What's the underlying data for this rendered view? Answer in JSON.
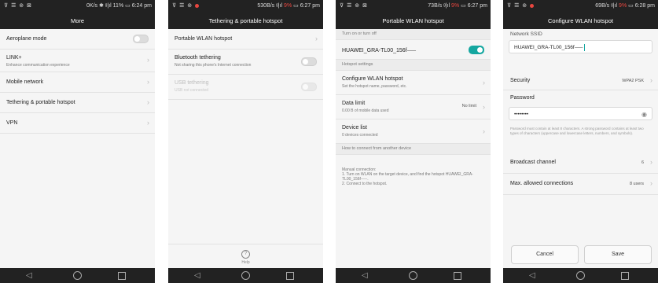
{
  "screens": [
    {
      "status": {
        "left": "⊽ ☰ ⊚ ⊠",
        "right_text": "0K/s ✱ ᵍ|ıl 11%",
        "time": "6:24 pm",
        "red_pct": ""
      },
      "title": "More",
      "items": [
        {
          "label": "Aeroplane mode",
          "sub": ""
        },
        {
          "label": "LINK+",
          "sub": "Enhance communication experience"
        },
        {
          "label": "Mobile network",
          "sub": ""
        },
        {
          "label": "Tethering & portable hotspot",
          "sub": ""
        },
        {
          "label": "VPN",
          "sub": ""
        }
      ]
    },
    {
      "status": {
        "left": "⊽ ☰ ⊚",
        "right_text": "530B/s ᵍ|ıl",
        "red_pct": "9%",
        "time": "6:27 pm"
      },
      "title": "Tethering & portable hotspot",
      "items": [
        {
          "label": "Portable WLAN hotspot",
          "sub": ""
        },
        {
          "label": "Bluetooth tethering",
          "sub": "Not sharing this phone's Internet connection"
        },
        {
          "label": "USB tethering",
          "sub": "USB not connected"
        }
      ],
      "help": "Help",
      "help_icon": "?"
    },
    {
      "status": {
        "left": "⊽ ☰ ⊚ ⊠",
        "right_text": "73B/s ᵍ|ıl",
        "red_pct": "9%",
        "time": "6:27 pm"
      },
      "title": "Portable WLAN hotspot",
      "section_toggle": "Turn on or turn off",
      "hotspot_name": "HUAWEI_GRA-TL00_156f⸺",
      "section_settings": "Hotspot settings",
      "items": [
        {
          "label": "Configure WLAN hotspot",
          "sub": "Set the hotspot name, password, etc."
        },
        {
          "label": "Data limit",
          "sub": "0.00 B of mobile data used",
          "value": "No limit"
        },
        {
          "label": "Device list",
          "sub": "0 devices connected"
        }
      ],
      "section_connect": "How to connect from another device",
      "manual": "Manual connection:\n1. Turn on WLAN on the target device, and find the hotspot HUAWEI_GRA-TL00_156f⸺.\n2. Connect to the hotspot."
    },
    {
      "status": {
        "left": "⊽ ☰ ⊚",
        "right_text": "69B/s ᵍ|ıl",
        "red_pct": "9%",
        "time": "6:28 pm"
      },
      "title": "Configure WLAN hotspot",
      "ssid_label": "Network SSID",
      "ssid_value": "HUAWEI_GRA-TL00_156f⸺",
      "security_label": "Security",
      "security_value": "WPA2 PSK",
      "password_label": "Password",
      "password_value": "••••••••",
      "password_hint": "Password must contain at least 8 characters. A strong password contains at least two types of characters (uppercase and lowercase letters, numbers, and symbols).",
      "broadcast_label": "Broadcast channel",
      "broadcast_value": "6",
      "max_label": "Max. allowed connections",
      "max_value": "8 users",
      "cancel": "Cancel",
      "save": "Save"
    }
  ],
  "icons": {
    "chevron": "›",
    "back": "◁",
    "eye": "◉"
  }
}
